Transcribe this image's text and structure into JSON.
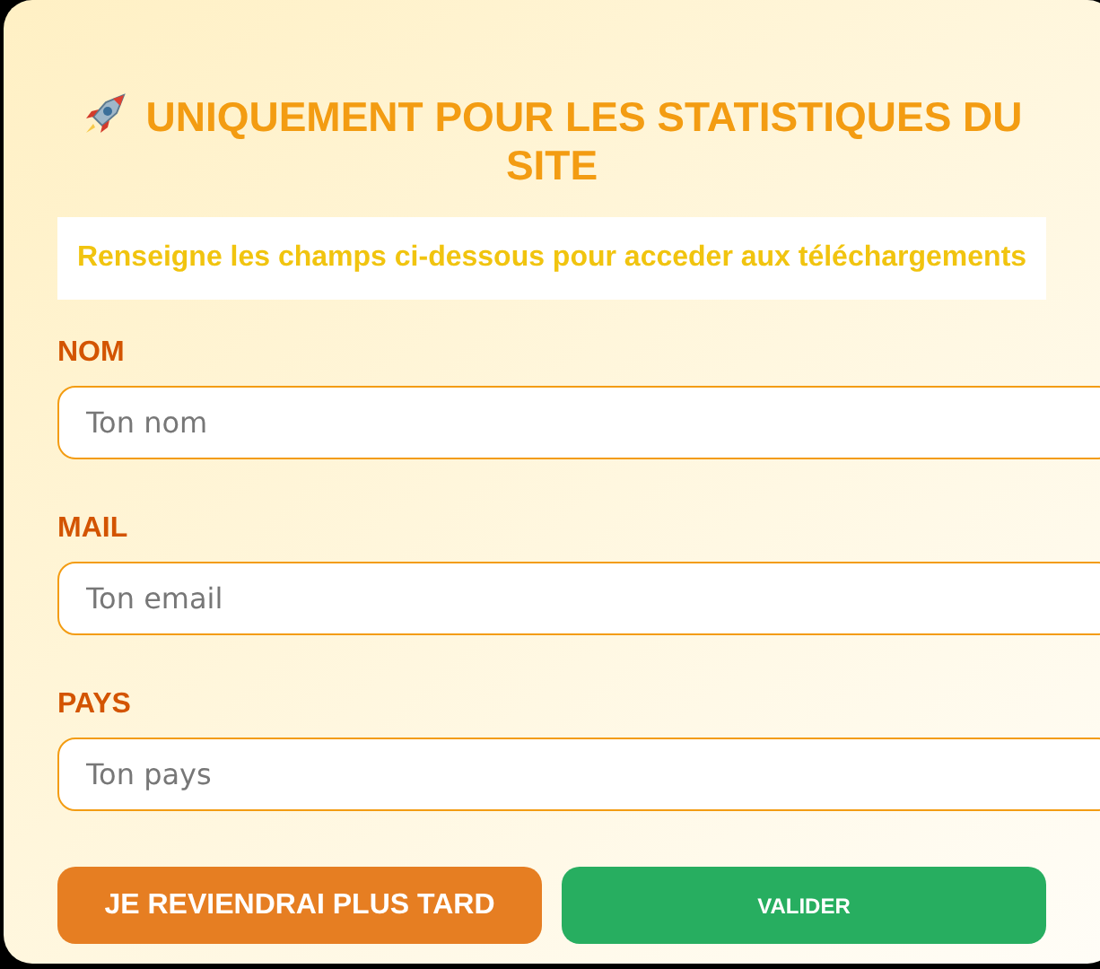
{
  "title": "UNIQUEMENT POUR LES STATISTIQUES DU SITE",
  "subtitle": "Renseigne les champs ci-dessous pour acceder aux téléchargements",
  "fields": [
    {
      "label": "NOM",
      "placeholder": "Ton nom"
    },
    {
      "label": "MAIL",
      "placeholder": "Ton email"
    },
    {
      "label": "PAYS",
      "placeholder": "Ton pays"
    }
  ],
  "buttons": [
    {
      "label": "JE REVIENDRAI PLUS TARD",
      "kind": "later"
    },
    {
      "label": "VALIDER",
      "kind": "submit"
    }
  ]
}
